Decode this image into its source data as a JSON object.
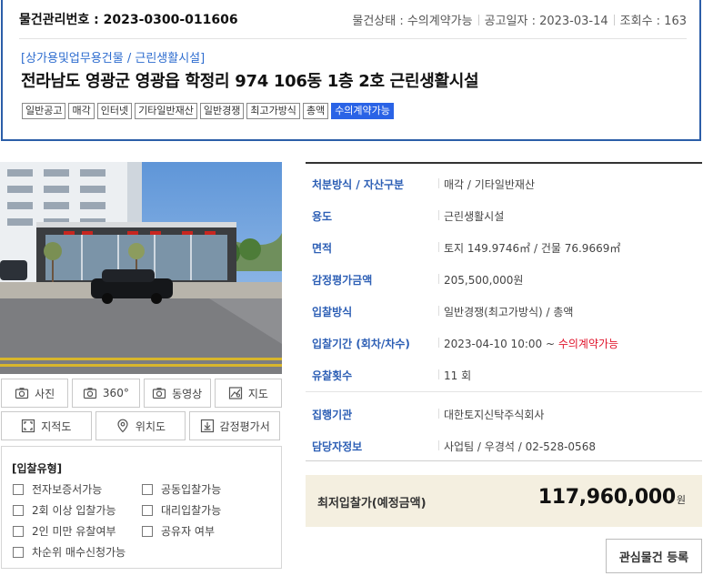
{
  "header": {
    "property_no": "물건관리번호 : 2023-0300-011606",
    "status": "물건상태 : 수의계약가능",
    "notice_date": "공고일자 : 2023-03-14",
    "views": "조회수 : 163",
    "category": "[상가용및업무용건물 / 근린생활시설]",
    "title": "전라남도 영광군 영광읍 학정리 974 106동 1층 2호 근린생활시설",
    "tags": [
      "일반공고",
      "매각",
      "인터넷",
      "기타일반재산",
      "일반경쟁",
      "최고가방식",
      "총액",
      "수의계약가능"
    ]
  },
  "media_buttons": {
    "photo": "사진",
    "view360": "360°",
    "video": "동영상",
    "map": "지도",
    "cadastral": "지적도",
    "location": "위치도",
    "appraisal": "감정평가서"
  },
  "bid_type": {
    "title": "[입찰유형]",
    "options": [
      "전자보증서가능",
      "공동입찰가능",
      "2회 이상 입찰가능",
      "대리입찰가능",
      "2인 미만 유찰여부",
      "공유자 여부",
      "차순위 매수신청가능"
    ]
  },
  "details": [
    {
      "label": "처분방식 / 자산구분",
      "value": "매각 / 기타일반재산"
    },
    {
      "label": "용도",
      "value": "근린생활시설"
    },
    {
      "label": "면적",
      "value": "토지 149.9746㎡ / 건물 76.9669㎡"
    },
    {
      "label": "감정평가금액",
      "value": "205,500,000원"
    },
    {
      "label": "입찰방식",
      "value": "일반경쟁(최고가방식) / 총액"
    },
    {
      "label": "입찰기간 (회차/차수)",
      "value": "2023-04-10 10:00 ~",
      "value_highlight": "수의계약가능"
    },
    {
      "label": "유찰횟수",
      "value": "11 회"
    },
    {
      "label": "집행기관",
      "value": "대한토지신탁주식회사"
    },
    {
      "label": "담당자정보",
      "value": "사업팀 / 우경석 / 02-528-0568"
    }
  ],
  "price": {
    "label": "최저입찰가(예정금액)",
    "value": "117,960,000",
    "unit": "원"
  },
  "favorite_button": "관심물건 등록",
  "colors": {
    "brand_blue": "#2c5ea8",
    "label_blue": "#2d5fb5",
    "tag_active": "#2a63e6",
    "highlight_red": "#e0142b",
    "price_bg": "#f4efe0"
  }
}
